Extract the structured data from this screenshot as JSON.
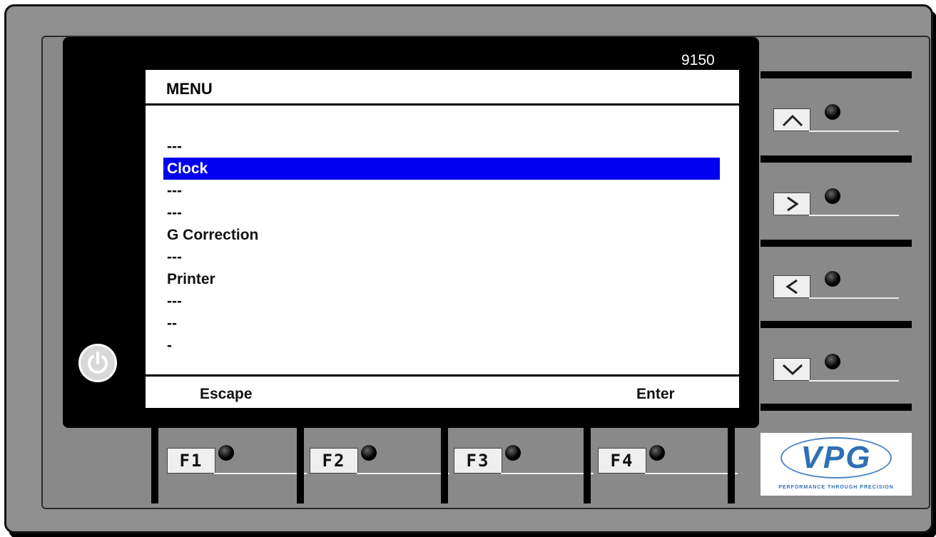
{
  "device": {
    "model": "9150"
  },
  "display": {
    "title": "MENU",
    "items": [
      {
        "label": "---",
        "selected": false
      },
      {
        "label": "Clock",
        "selected": true
      },
      {
        "label": "---",
        "selected": false
      },
      {
        "label": "---",
        "selected": false
      },
      {
        "label": "G Correction",
        "selected": false
      },
      {
        "label": "---",
        "selected": false
      },
      {
        "label": "Printer",
        "selected": false
      },
      {
        "label": "---",
        "selected": false
      },
      {
        "label": "--",
        "selected": false
      },
      {
        "label": "-",
        "selected": false
      }
    ],
    "softkeys": {
      "left": "Escape",
      "right": "Enter"
    },
    "highlight_color": "#0000f0"
  },
  "nav_keys": [
    {
      "icon": "chevron-up-icon"
    },
    {
      "icon": "chevron-right-icon"
    },
    {
      "icon": "chevron-left-icon"
    },
    {
      "icon": "chevron-down-icon"
    }
  ],
  "function_keys": [
    "F1",
    "F2",
    "F3",
    "F4"
  ],
  "power_button": {
    "icon": "power-icon"
  },
  "logo": {
    "brand": "VPG",
    "tagline": "PERFORMANCE THROUGH PRECISION",
    "color": "#2f6fb5"
  }
}
